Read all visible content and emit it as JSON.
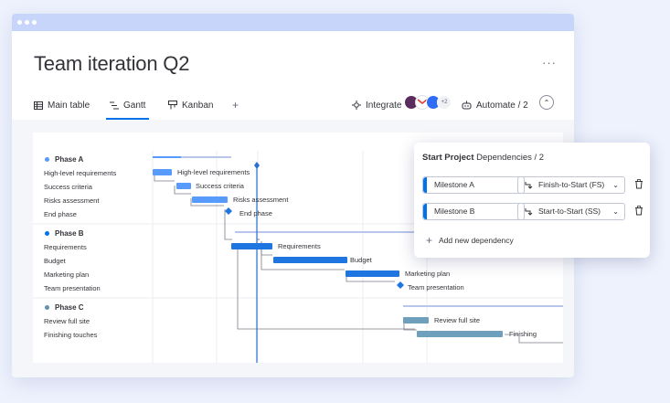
{
  "board": {
    "title": "Team iteration Q2",
    "more_label": "···"
  },
  "tabs": [
    {
      "label": "Main table",
      "icon": "table-icon",
      "active": false
    },
    {
      "label": "Gantt",
      "icon": "gantt-icon",
      "active": true
    },
    {
      "label": "Kanban",
      "icon": "kanban-icon",
      "active": false
    }
  ],
  "add_view_label": "+",
  "toolbar": {
    "integrate_label": "Integrate",
    "integrations_extra": "+2",
    "automate_label": "Automate / 2",
    "collapse_label": "⌃"
  },
  "phases": [
    {
      "name": "Phase A",
      "color": "#579bfc",
      "tasks": [
        "High-level requirements",
        "Success criteria",
        "Risks assessment",
        "End phase"
      ]
    },
    {
      "name": "Phase B",
      "color": "#0073ea",
      "tasks": [
        "Requirements",
        "Budget",
        "Marketing plan",
        "Team presentation"
      ]
    },
    {
      "name": "Phase C",
      "color": "#5f93b0",
      "tasks": [
        "Review full site",
        "Finishing touches"
      ]
    }
  ],
  "bar_labels": {
    "a1": "High-level requirements",
    "a2": "Success criteria",
    "a3": "Risks assessment",
    "a4": "End phase",
    "b1": "Requirements",
    "b2": "Budget",
    "b3": "Marketing plan",
    "b4": "Team presentation",
    "c1": "Review full site",
    "c2": "Finishing"
  },
  "dependencies_popup": {
    "title_bold": "Start Project",
    "title_rest": " Dependencies / 2",
    "items": [
      {
        "name": "Milestone A",
        "type": "Finish-to-Start (FS)"
      },
      {
        "name": "Milestone B",
        "type": "Start-to-Start (SS)"
      }
    ],
    "add_label": "Add new dependency"
  },
  "colors": {
    "accent": "#0073ea",
    "phase_a_bar": "#579bfc",
    "phase_b_bar": "#1f76e0",
    "phase_c_bar": "#6e9fbd",
    "today_line": "#2a6fd6"
  }
}
